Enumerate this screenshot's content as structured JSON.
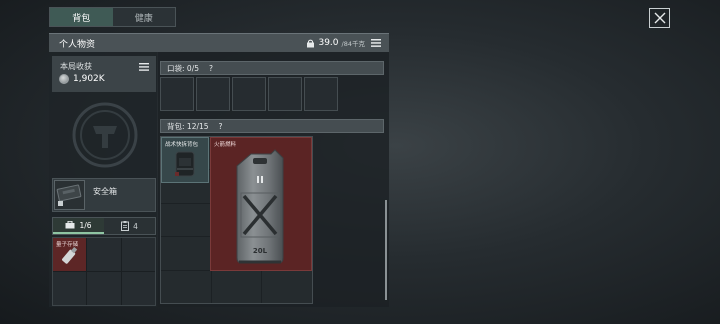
{
  "tabs": [
    {
      "label": "背包",
      "active": true
    },
    {
      "label": "健康",
      "active": false
    }
  ],
  "panel": {
    "title": "个人物资",
    "weight_value": "39.0",
    "weight_max": "/84千克"
  },
  "earnings": {
    "label": "本局收获",
    "value": "1,902K"
  },
  "safe_box": {
    "label": "安全箱"
  },
  "subtabs": [
    {
      "label": "1/6",
      "icon": "case-icon",
      "active": true
    },
    {
      "label": "4",
      "icon": "clipboard-icon",
      "active": false
    }
  ],
  "pockets": {
    "label": "口袋:",
    "count": "0/5",
    "help": "?"
  },
  "backpack": {
    "label": "背包:",
    "count": "12/15",
    "help": "?"
  },
  "items": {
    "usb": {
      "label": "量子存储"
    },
    "vest": {
      "label": "战术快拆背包"
    },
    "fuel": {
      "label": "火箭燃料",
      "can_text": "20L"
    }
  },
  "colors": {
    "accent_green": "#8fc5a3",
    "rare_red": "#5b2424",
    "panel_header": "#4a5256"
  }
}
